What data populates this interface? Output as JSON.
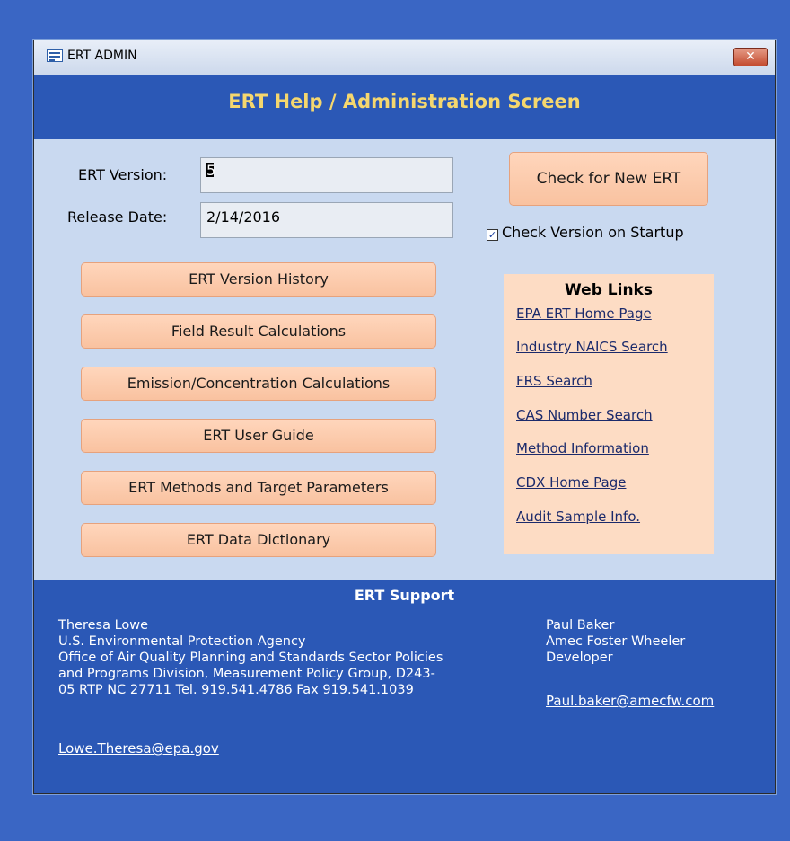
{
  "window": {
    "title": "ERT ADMIN",
    "close_label": "✕"
  },
  "header": {
    "title": "ERT Help / Administration Screen"
  },
  "form": {
    "version_label": "ERT Version:",
    "version_value": "5",
    "release_label": "Release Date:",
    "release_value": "2/14/2016"
  },
  "check_new_label": "Check for New ERT",
  "check_startup": {
    "label": "Check Version on Startup",
    "checked": true
  },
  "buttons": [
    "ERT Version History",
    "Field Result Calculations",
    "Emission/Concentration Calculations",
    "ERT User Guide",
    "ERT Methods and Target Parameters",
    "ERT Data Dictionary"
  ],
  "web_links": {
    "title": "Web Links",
    "links": [
      "EPA ERT Home Page",
      "Industry NAICS Search",
      "FRS Search",
      "CAS Number Search",
      "Method Information",
      "CDX Home Page",
      "Audit Sample Info."
    ]
  },
  "support": {
    "title": "ERT Support",
    "left_lines": [
      "Theresa Lowe",
      "U.S. Environmental Protection Agency",
      "Office of Air Quality Planning and Standards Sector Policies",
      "and Programs Division, Measurement Policy Group, D243-",
      "05 RTP NC 27711  Tel. 919.541.4786 Fax 919.541.1039"
    ],
    "left_email": "Lowe.Theresa@epa.gov",
    "right_lines": [
      "Paul Baker",
      "Amec Foster Wheeler",
      "Developer"
    ],
    "right_email": "Paul.baker@amecfw.com"
  },
  "colors": {
    "desktop": "#3a66c4",
    "band": "#2b58b6",
    "title_gold": "#f5d76e",
    "button": "#f9c2a0",
    "weblinks_bg": "#fddcc4"
  }
}
